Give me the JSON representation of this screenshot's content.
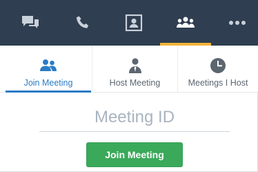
{
  "nav": {
    "items": [
      {
        "icon": "chat-icon",
        "active": false
      },
      {
        "icon": "phone-icon",
        "active": false
      },
      {
        "icon": "contacts-icon",
        "active": false
      },
      {
        "icon": "meetings-icon",
        "active": true
      },
      {
        "icon": "more-icon",
        "active": false
      }
    ],
    "active_color": "#f2b43a",
    "background": "#2f3e50"
  },
  "tabs": [
    {
      "label": "Join Meeting",
      "icon": "join-meeting-icon",
      "active": true
    },
    {
      "label": "Host Meeting",
      "icon": "host-meeting-icon",
      "active": false
    },
    {
      "label": "Meetings I Host",
      "icon": "clock-icon",
      "active": false
    }
  ],
  "form": {
    "meeting_id_placeholder": "Meeting ID",
    "meeting_id_value": "",
    "join_button_label": "Join Meeting"
  },
  "colors": {
    "accent": "#2b7cc5",
    "join_button": "#3aa95a"
  }
}
